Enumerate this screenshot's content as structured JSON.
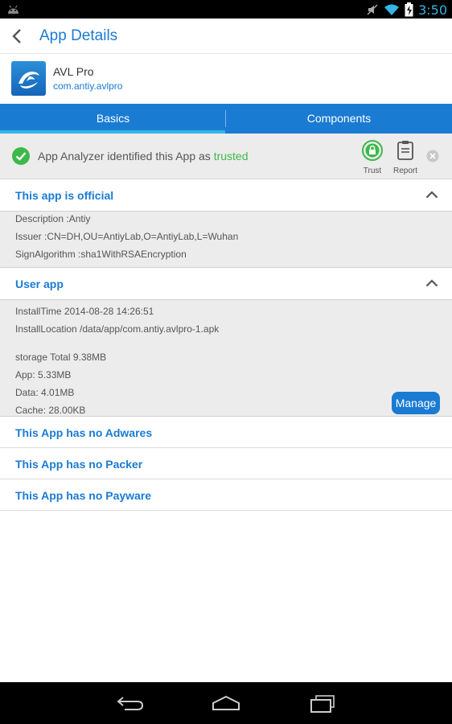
{
  "status_bar": {
    "time": "3:50",
    "icons": [
      "android-icon",
      "mute-icon",
      "wifi-icon",
      "battery-charging-icon"
    ]
  },
  "action_bar": {
    "title": "App Details",
    "back_icon": "back-arrow-icon"
  },
  "app": {
    "name": "AVL Pro",
    "package": "com.antiy.avlpro",
    "icon": "avl-logo-icon"
  },
  "tabs": [
    {
      "label": "Basics",
      "selected": true
    },
    {
      "label": "Components",
      "selected": false
    }
  ],
  "analyzer": {
    "message_prefix": "App Analyzer identified this App as ",
    "message_status": "trusted",
    "trust_label": "Trust",
    "report_label": "Report",
    "status_color": "#3cb94a"
  },
  "sections": {
    "official": {
      "title": "This app is official",
      "lines": [
        "Description :Antiy",
        "Issuer :CN=DH,OU=AntiyLab,O=AntiyLab,L=Wuhan",
        "SignAlgorithm :sha1WithRSAEncryption"
      ]
    },
    "user": {
      "title": "User app",
      "install_time": "InstallTime 2014-08-28 14:26:51",
      "install_location": "InstallLocation /data/app/com.antiy.avlpro-1.apk",
      "storage_total": "storage Total 9.38MB",
      "app_size": "App: 5.33MB",
      "data_size": "Data: 4.01MB",
      "cache_size": "Cache: 28.00KB",
      "manage_label": "Manage"
    }
  },
  "rows": [
    "This App has no Adwares",
    "This App has no Packer",
    "This App has no Payware"
  ],
  "colors": {
    "accent": "#1a7bd3",
    "tab_indicator": "#33b5e5",
    "trusted": "#3cb94a"
  }
}
